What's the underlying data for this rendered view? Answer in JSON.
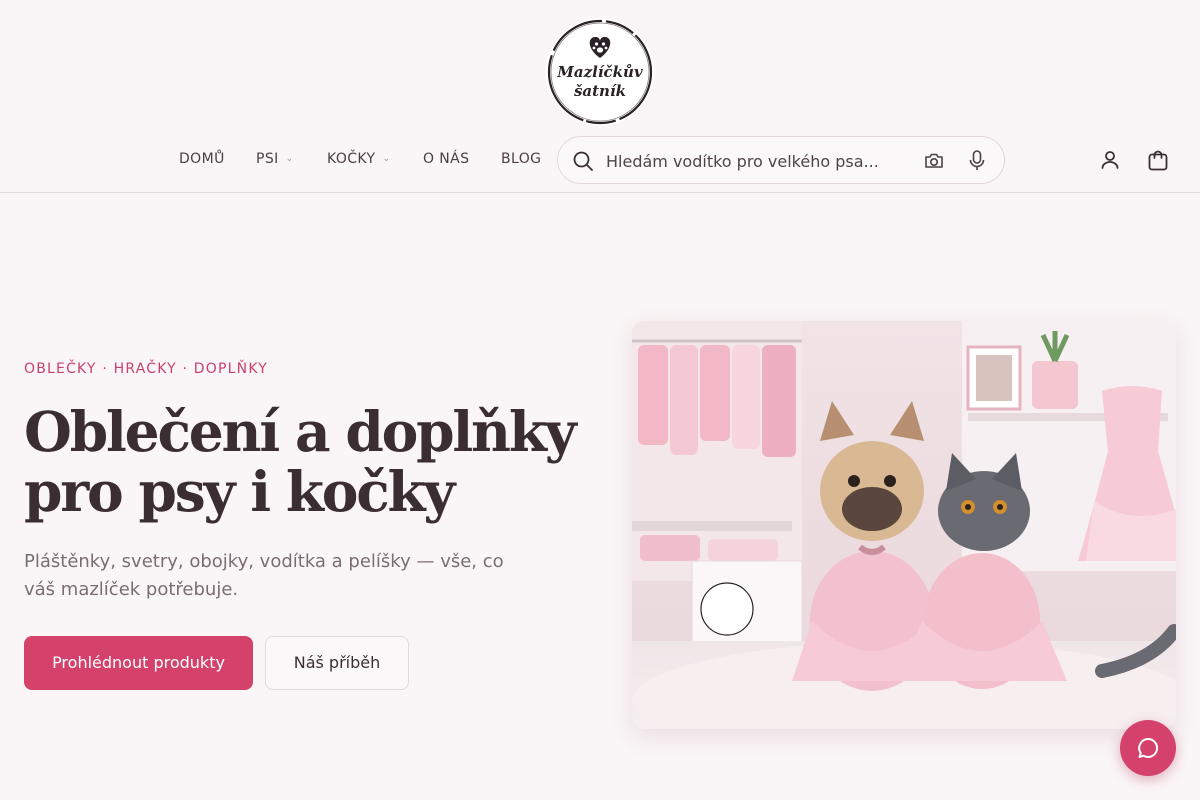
{
  "logo": {
    "line1": "Mazlíčkův",
    "line2": "šatník",
    "icon": "paw-heart-icon"
  },
  "nav": {
    "items": [
      {
        "label": "DOMŮ",
        "dropdown": false
      },
      {
        "label": "PSI",
        "dropdown": true
      },
      {
        "label": "KOČKY",
        "dropdown": true
      },
      {
        "label": "O NÁS",
        "dropdown": false
      },
      {
        "label": "BLOG",
        "dropdown": false
      }
    ]
  },
  "search": {
    "placeholder": "Hledám vodítko pro velkého psa...",
    "icons": [
      "search-icon",
      "camera-icon",
      "mic-icon"
    ]
  },
  "header_icons": [
    "account-icon",
    "cart-icon"
  ],
  "hero": {
    "eyebrow": "OBLEČKY · HRAČKY · DOPLŇKY",
    "title_line1": "Oblečení a doplňky",
    "title_line2": "pro psy i kočky",
    "subtitle": "Pláštěnky, svetry, obojky, vodítka a pelíšky — vše, co váš mazlíček potřebuje.",
    "primary_button": "Prohlédnout produkty",
    "secondary_button": "Náš příběh"
  },
  "colors": {
    "accent": "#d4426c",
    "background": "#faf5f6",
    "text": "#3a2e32",
    "muted": "#7a6e73"
  }
}
